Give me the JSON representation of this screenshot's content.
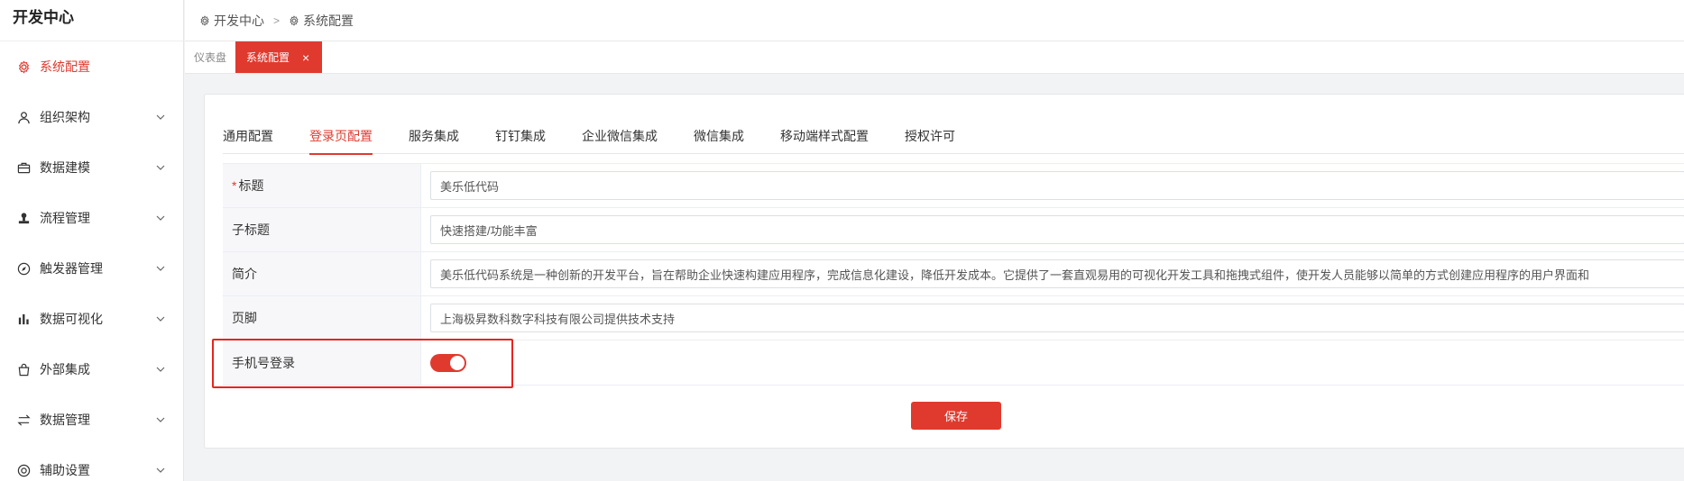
{
  "app": {
    "title": "开发中心"
  },
  "sidebar": {
    "items": [
      {
        "label": "系统配置",
        "icon": "gear-icon",
        "active": true
      },
      {
        "label": "组织架构",
        "icon": "user-icon"
      },
      {
        "label": "数据建模",
        "icon": "briefcase-icon"
      },
      {
        "label": "流程管理",
        "icon": "stamp-icon"
      },
      {
        "label": "触发器管理",
        "icon": "compass-icon"
      },
      {
        "label": "数据可视化",
        "icon": "bar-chart-icon"
      },
      {
        "label": "外部集成",
        "icon": "bag-icon"
      },
      {
        "label": "数据管理",
        "icon": "swap-icon"
      },
      {
        "label": "辅助设置",
        "icon": "lifebuoy-icon"
      }
    ]
  },
  "breadcrumb": [
    "开发中心",
    "系统配置"
  ],
  "pagetabs": [
    {
      "label": "仪表盘"
    },
    {
      "label": "系统配置",
      "active": true
    }
  ],
  "tabs": [
    "通用配置",
    "登录页配置",
    "服务集成",
    "钉钉集成",
    "企业微信集成",
    "微信集成",
    "移动端样式配置",
    "授权许可"
  ],
  "form": {
    "title_label": "标题",
    "title_value": "美乐低代码",
    "subtitle_label": "子标题",
    "subtitle_value": "快速搭建/功能丰富",
    "intro_label": "简介",
    "intro_value": "美乐低代码系统是一种创新的开发平台，旨在帮助企业快速构建应用程序，完成信息化建设，降低开发成本。它提供了一套直观易用的可视化开发工具和拖拽式组件，使开发人员能够以简单的方式创建应用程序的用户界面和",
    "footer_label": "页脚",
    "footer_value": "上海极昇数科数字科技有限公司提供技术支持",
    "phone_login_label": "手机号登录",
    "phone_login_enabled": true
  },
  "save_label": "保存",
  "colors": {
    "accent": "#e03a2f"
  }
}
